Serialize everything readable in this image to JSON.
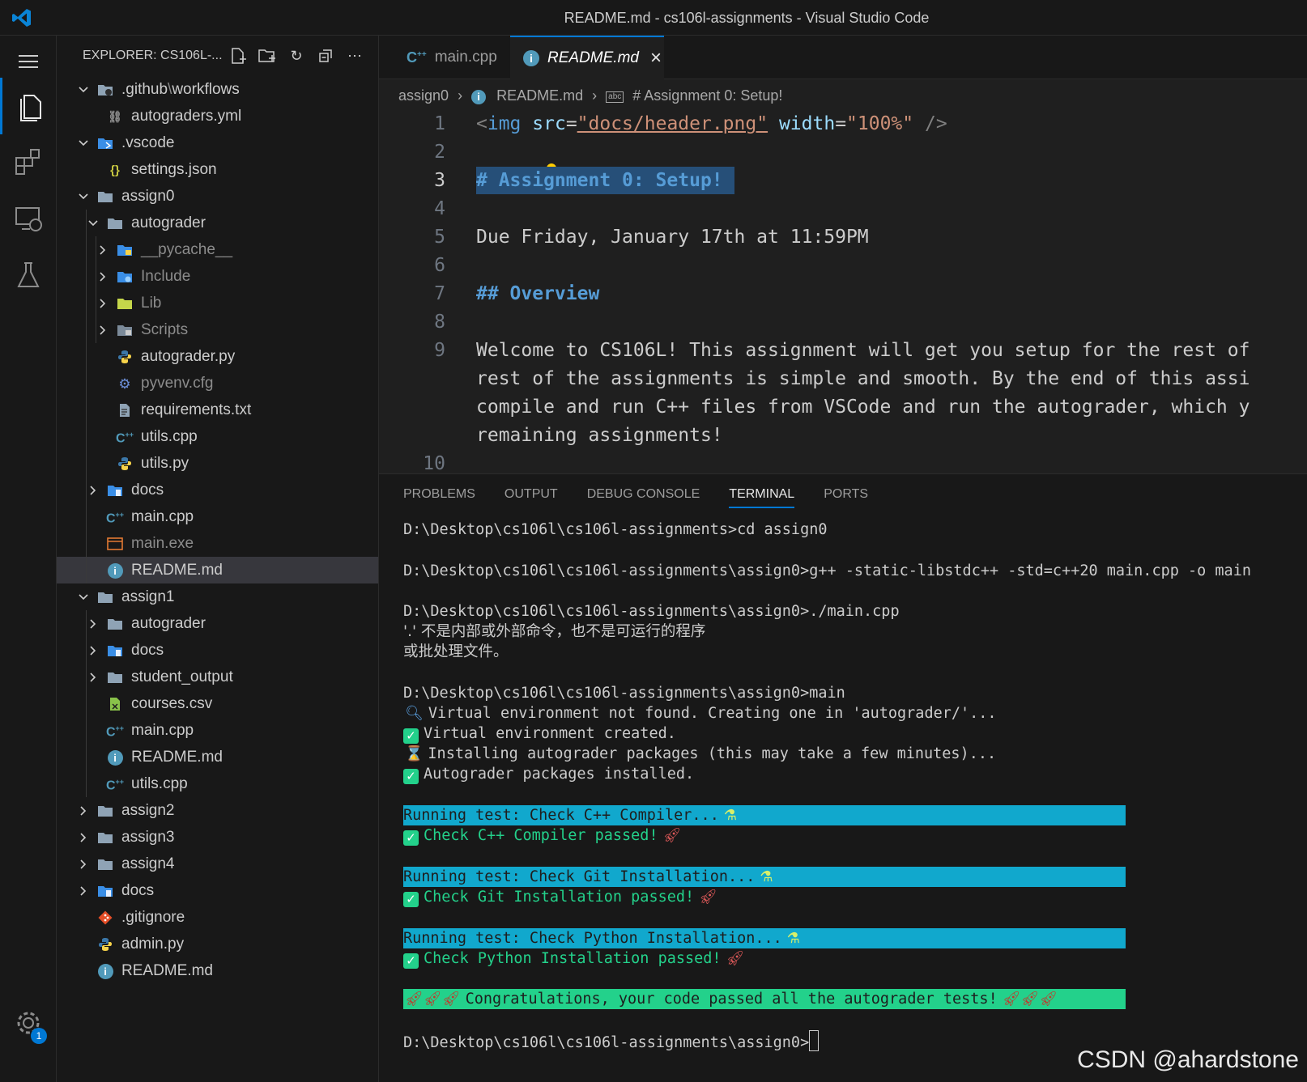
{
  "window": {
    "title": "README.md - cs106l-assignments - Visual Studio Code"
  },
  "activity": {
    "settings_badge": "1"
  },
  "explorer": {
    "header": "EXPLORER: CS106L-...",
    "tree": [
      {
        "label": ".github",
        "suffix": "workflows",
        "sep": "\\",
        "depth": 0,
        "chevron": "open",
        "icon": "github-folder-icon"
      },
      {
        "label": "autograders.yml",
        "depth": 1,
        "icon": "yaml-icon"
      },
      {
        "label": ".vscode",
        "depth": 0,
        "chevron": "open",
        "icon": "vscode-folder-icon"
      },
      {
        "label": "settings.json",
        "depth": 1,
        "icon": "json-icon"
      },
      {
        "label": "assign0",
        "depth": 0,
        "chevron": "open",
        "icon": "folder-icon"
      },
      {
        "label": "autograder",
        "depth": 1,
        "chevron": "open",
        "icon": "folder-icon"
      },
      {
        "label": "__pycache__",
        "depth": 2,
        "chevron": "closed",
        "icon": "python-folder-icon",
        "dim": true
      },
      {
        "label": "Include",
        "depth": 2,
        "chevron": "closed",
        "icon": "include-folder-icon",
        "dim": true
      },
      {
        "label": "Lib",
        "depth": 2,
        "chevron": "closed",
        "icon": "lib-folder-icon",
        "dim": true
      },
      {
        "label": "Scripts",
        "depth": 2,
        "chevron": "closed",
        "icon": "scripts-folder-icon",
        "dim": true
      },
      {
        "label": "autograder.py",
        "depth": 2,
        "icon": "python-icon"
      },
      {
        "label": "pyvenv.cfg",
        "depth": 2,
        "icon": "gear-icon",
        "dim": true
      },
      {
        "label": "requirements.txt",
        "depth": 2,
        "icon": "text-file-icon"
      },
      {
        "label": "utils.cpp",
        "depth": 2,
        "icon": "cpp-icon"
      },
      {
        "label": "utils.py",
        "depth": 2,
        "icon": "python-icon"
      },
      {
        "label": "docs",
        "depth": 1,
        "chevron": "closed",
        "icon": "docs-folder-icon"
      },
      {
        "label": "main.cpp",
        "depth": 1,
        "icon": "cpp-icon"
      },
      {
        "label": "main.exe",
        "depth": 1,
        "icon": "exe-icon",
        "dim": true
      },
      {
        "label": "README.md",
        "depth": 1,
        "icon": "info-icon",
        "selected": true
      },
      {
        "label": "assign1",
        "depth": 0,
        "chevron": "open",
        "icon": "folder-icon"
      },
      {
        "label": "autograder",
        "depth": 1,
        "chevron": "closed",
        "icon": "folder-icon"
      },
      {
        "label": "docs",
        "depth": 1,
        "chevron": "closed",
        "icon": "docs-folder-icon"
      },
      {
        "label": "student_output",
        "depth": 1,
        "chevron": "closed",
        "icon": "folder-icon"
      },
      {
        "label": "courses.csv",
        "depth": 1,
        "icon": "csv-icon"
      },
      {
        "label": "main.cpp",
        "depth": 1,
        "icon": "cpp-icon"
      },
      {
        "label": "README.md",
        "depth": 1,
        "icon": "info-icon"
      },
      {
        "label": "utils.cpp",
        "depth": 1,
        "icon": "cpp-icon"
      },
      {
        "label": "assign2",
        "depth": 0,
        "chevron": "closed",
        "icon": "folder-icon"
      },
      {
        "label": "assign3",
        "depth": 0,
        "chevron": "closed",
        "icon": "folder-icon"
      },
      {
        "label": "assign4",
        "depth": 0,
        "chevron": "closed",
        "icon": "folder-icon"
      },
      {
        "label": "docs",
        "depth": 0,
        "chevron": "closed",
        "icon": "docs-folder-icon"
      },
      {
        "label": ".gitignore",
        "depth": 0,
        "icon": "git-icon"
      },
      {
        "label": "admin.py",
        "depth": 0,
        "icon": "python-icon"
      },
      {
        "label": "README.md",
        "depth": 0,
        "icon": "info-icon"
      }
    ]
  },
  "tabs": [
    {
      "label": "main.cpp",
      "icon": "cpp-icon",
      "active": false
    },
    {
      "label": "README.md",
      "icon": "info-icon",
      "active": true,
      "close": "×"
    }
  ],
  "breadcrumb": {
    "folder": "assign0",
    "file": "README.md",
    "symbol": "# Assignment 0: Setup!"
  },
  "editor": {
    "line_numbers": [
      "1",
      "2",
      "3",
      "4",
      "5",
      "6",
      "7",
      "8",
      "9",
      "",
      "",
      "",
      "10"
    ],
    "line1": {
      "open": "<",
      "tag": "img",
      "attr1": "src",
      "eq": "=",
      "val1": "\"docs/header.png\"",
      "attr2": "width",
      "val2": "\"100%\"",
      "close": "/>"
    },
    "line3": "# Assignment 0: Setup!",
    "line5": "Due Friday, January 17th at 11:59PM",
    "line7": "## Overview",
    "line9": [
      "Welcome to CS106L! This assignment will get you setup for the rest of",
      "rest of the assignments is simple and smooth. By the end of this assi",
      "compile and run C++ files from VSCode and run the autograder, which y",
      "remaining assignments!"
    ]
  },
  "panel": {
    "tabs": [
      "PROBLEMS",
      "OUTPUT",
      "DEBUG CONSOLE",
      "TERMINAL",
      "PORTS"
    ],
    "active_tab": "TERMINAL"
  },
  "terminal": {
    "l1": "D:\\Desktop\\cs106l\\cs106l-assignments>cd assign0",
    "l2": "D:\\Desktop\\cs106l\\cs106l-assignments\\assign0>g++ -static-libstdc++ -std=c++20 main.cpp -o main",
    "l3": "D:\\Desktop\\cs106l\\cs106l-assignments\\assign0>./main.cpp",
    "l4": "'.' 不是内部或外部命令，也不是可运行的程序",
    "l5": "或批处理文件。",
    "l6": "D:\\Desktop\\cs106l\\cs106l-assignments\\assign0>main",
    "l7": "Virtual environment not found. Creating one in 'autograder/'...",
    "l8": "Virtual environment created.",
    "l9": "Installing autograder packages (this may take a few minutes)...",
    "l10": "Autograder packages installed.",
    "t1": "Running test: Check C++ Compiler...",
    "p1": "Check C++ Compiler passed!",
    "t2": "Running test: Check Git Installation...",
    "p2": "Check Git Installation passed!",
    "t3": "Running test: Check Python Installation...",
    "p3": "Check Python Installation passed!",
    "congrats": "Congratulations, your code passed all the autograder tests!",
    "prompt": "D:\\Desktop\\cs106l\\cs106l-assignments\\assign0>"
  },
  "watermark": "CSDN @ahardstone",
  "colors": {
    "accent": "#0078d4",
    "test_bar": "#11a8cd",
    "pass_green": "#23d18b"
  }
}
